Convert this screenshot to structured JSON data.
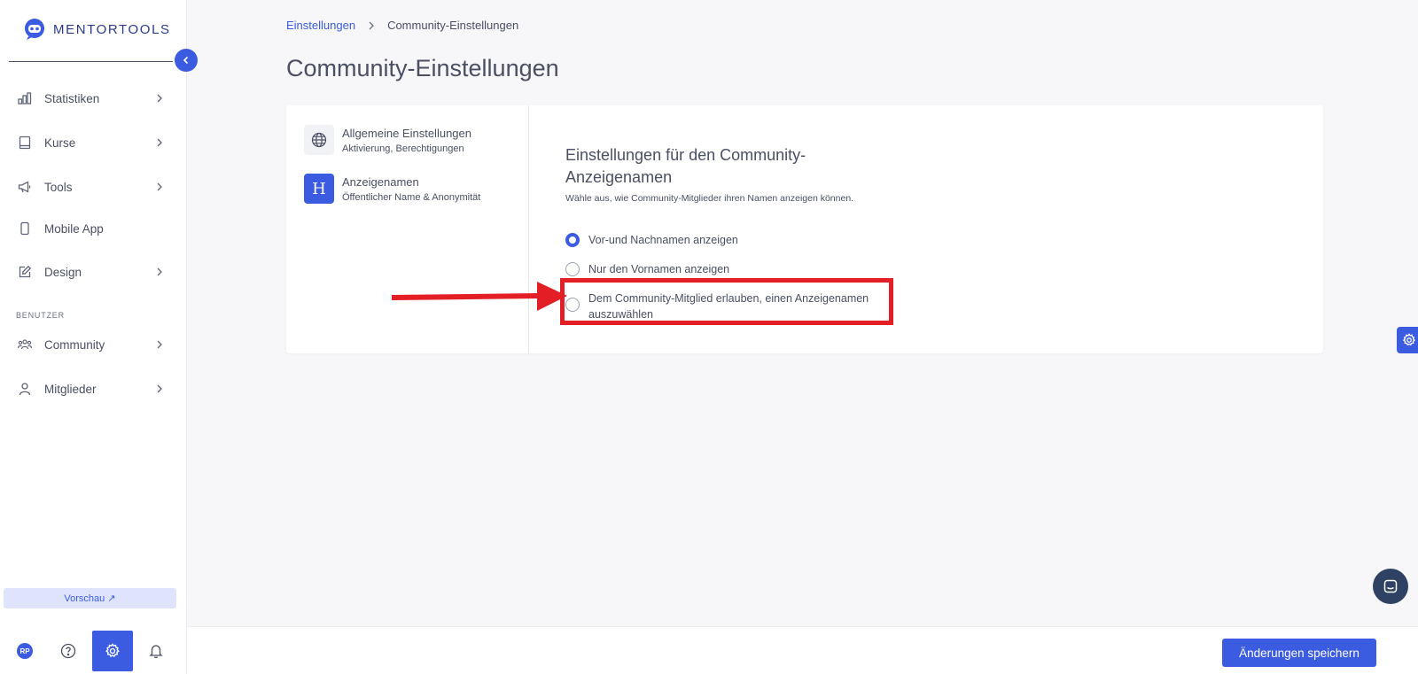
{
  "brand": {
    "name": "MENTORTOOLS"
  },
  "sidebar": {
    "items": [
      {
        "label": "Statistiken",
        "icon": "bar-chart-icon"
      },
      {
        "label": "Kurse",
        "icon": "book-icon"
      },
      {
        "label": "Tools",
        "icon": "megaphone-icon"
      },
      {
        "label": "Mobile App",
        "icon": "phone-icon"
      },
      {
        "label": "Design",
        "icon": "edit-icon"
      },
      {
        "label": "Community",
        "icon": "users-icon"
      },
      {
        "label": "Mitglieder",
        "icon": "user-icon"
      }
    ],
    "section_label": "BENUTZER",
    "preview_label": "Vorschau ↗",
    "avatar_initials": "RP"
  },
  "breadcrumb": {
    "parent": "Einstellungen",
    "current": "Community-Einstellungen"
  },
  "page": {
    "title": "Community-Einstellungen"
  },
  "settings_nav": [
    {
      "title": "Allgemeine Einstellungen",
      "subtitle": "Aktivierung, Berechtigungen",
      "icon": "globe-icon"
    },
    {
      "title": "Anzeigenamen",
      "subtitle": "Öffentlicher Name & Anonymität",
      "icon_text": "H"
    }
  ],
  "display_names": {
    "title": "Einstellungen für den Community-Anzeigenamen",
    "description": "Wähle aus, wie Community-Mitglieder ihren Namen anzeigen können.",
    "options": [
      {
        "label": "Vor-und Nachnamen anzeigen",
        "checked": true
      },
      {
        "label": "Nur den Vornamen anzeigen",
        "checked": false
      },
      {
        "label": "Dem Community-Mitglied erlauben, einen Anzeigenamen auszuwählen",
        "checked": false
      }
    ]
  },
  "footer": {
    "save_label": "Änderungen speichern"
  },
  "colors": {
    "accent": "#3b5be0",
    "annotation": "#e31e24",
    "chat": "#2f4263"
  }
}
